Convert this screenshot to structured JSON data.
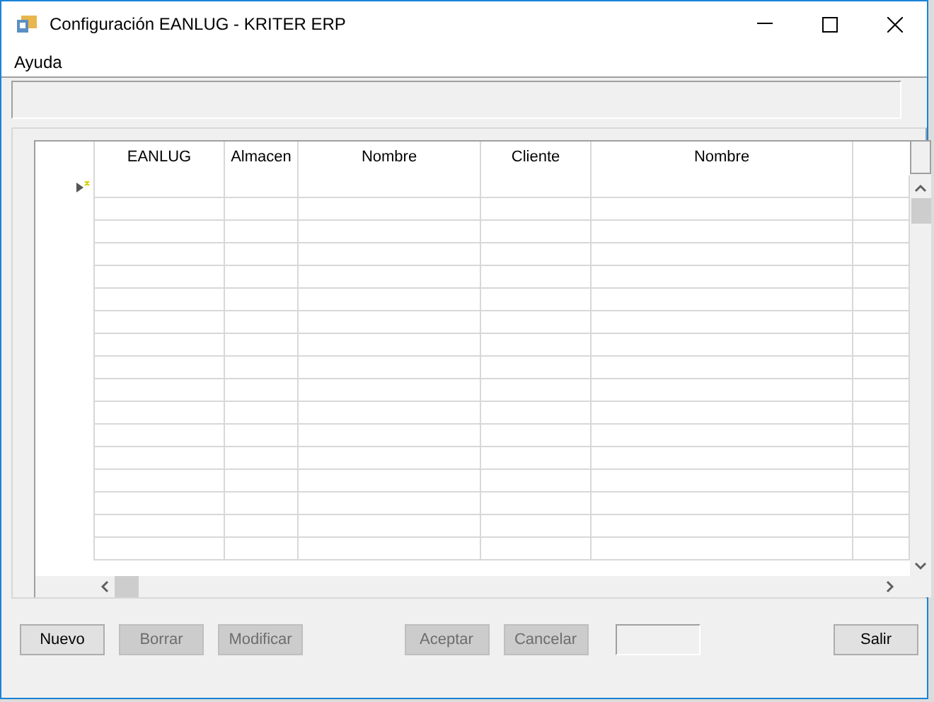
{
  "window": {
    "title": "Configuración EANLUG - KRITER ERP"
  },
  "menu": [
    "Ayuda"
  ],
  "table": {
    "columns": [
      {
        "label": "EANLUG"
      },
      {
        "label": "Almacen"
      },
      {
        "label": "Nombre"
      },
      {
        "label": "Cliente"
      },
      {
        "label": "Nombre"
      }
    ]
  },
  "buttons": [
    {
      "kind": "button",
      "label": "Nuevo",
      "disabled": false
    },
    {
      "kind": "button",
      "label": "Borrar",
      "disabled": true
    },
    {
      "kind": "button",
      "label": "Modificar",
      "disabled": true
    },
    {
      "kind": "spacer"
    },
    {
      "kind": "button",
      "label": "Aceptar",
      "disabled": true
    },
    {
      "kind": "button",
      "label": "Cancelar",
      "disabled": true
    },
    {
      "kind": "field"
    },
    {
      "kind": "spacer"
    },
    {
      "kind": "button",
      "label": "Salir",
      "disabled": false
    }
  ]
}
